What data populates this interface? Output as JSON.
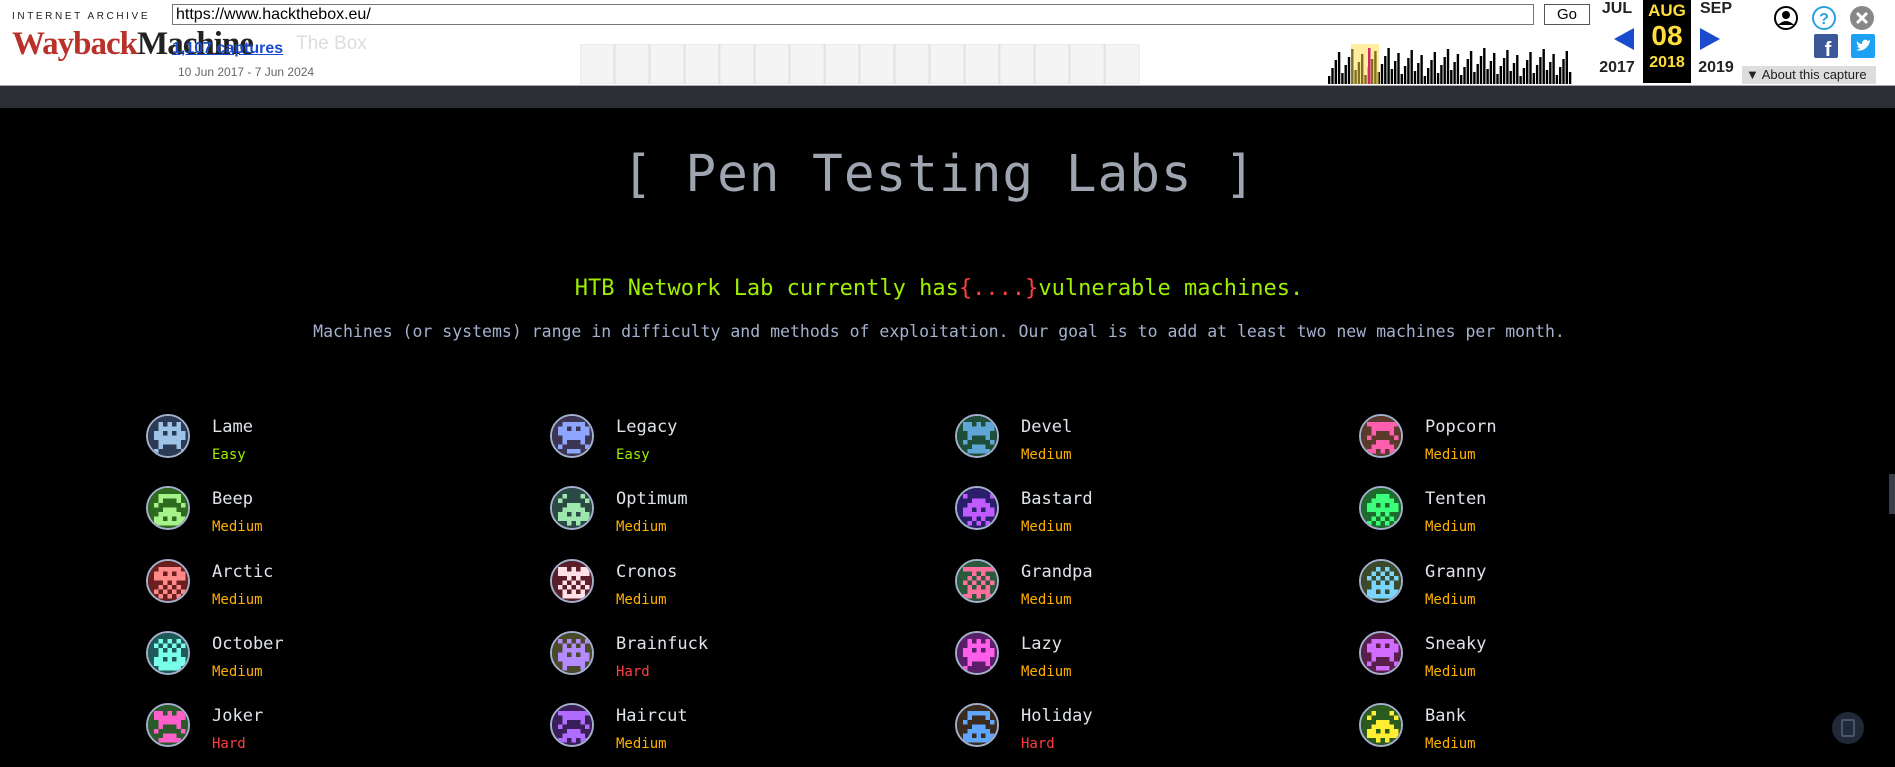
{
  "wayback": {
    "ia_label": "INTERNET ARCHIVE",
    "logo_red": "Wayback",
    "logo_dark": "Machine",
    "url": "https://www.hackthebox.eu/",
    "go_label": "Go",
    "captures": "1,107 captures",
    "date_range": "10 Jun 2017 - 7 Jun 2024",
    "ghost_text": "The Box",
    "prev_month": "JUL",
    "prev_year": "2017",
    "cur_month": "AUG",
    "cur_day": "08",
    "cur_year": "2018",
    "next_month": "SEP",
    "next_year": "2019",
    "about": "About this capture",
    "colors": {
      "logo_red": "#b8322a",
      "link_blue": "#1a4bcc",
      "highlight": "#ffde3b"
    }
  },
  "page": {
    "title": "[ Pen Testing Labs ]",
    "lab_prefix": "HTB Network Lab currently has",
    "lab_count": "{....}",
    "lab_suffix": "vulnerable machines.",
    "subtitle": "Machines (or systems) range in difficulty and methods of exploitation. Our goal is to add at least two new machines per month.",
    "colors": {
      "accent_green": "#9fef00",
      "easy": "#9fef00",
      "medium": "#ffaf00",
      "hard": "#ff3e3e"
    }
  },
  "machines": [
    {
      "name": "Lame",
      "difficulty": "Easy",
      "icon": "lame-avatar-icon"
    },
    {
      "name": "Legacy",
      "difficulty": "Easy",
      "icon": "legacy-avatar-icon"
    },
    {
      "name": "Devel",
      "difficulty": "Medium",
      "icon": "devel-avatar-icon"
    },
    {
      "name": "Popcorn",
      "difficulty": "Medium",
      "icon": "popcorn-avatar-icon"
    },
    {
      "name": "Beep",
      "difficulty": "Medium",
      "icon": "beep-avatar-icon"
    },
    {
      "name": "Optimum",
      "difficulty": "Medium",
      "icon": "optimum-avatar-icon"
    },
    {
      "name": "Bastard",
      "difficulty": "Medium",
      "icon": "bastard-avatar-icon"
    },
    {
      "name": "Tenten",
      "difficulty": "Medium",
      "icon": "tenten-avatar-icon"
    },
    {
      "name": "Arctic",
      "difficulty": "Medium",
      "icon": "arctic-avatar-icon"
    },
    {
      "name": "Cronos",
      "difficulty": "Medium",
      "icon": "cronos-avatar-icon"
    },
    {
      "name": "Grandpa",
      "difficulty": "Medium",
      "icon": "grandpa-avatar-icon"
    },
    {
      "name": "Granny",
      "difficulty": "Medium",
      "icon": "granny-avatar-icon"
    },
    {
      "name": "October",
      "difficulty": "Medium",
      "icon": "october-avatar-icon"
    },
    {
      "name": "Brainfuck",
      "difficulty": "Hard",
      "icon": "brainfuck-avatar-icon"
    },
    {
      "name": "Lazy",
      "difficulty": "Medium",
      "icon": "lazy-avatar-icon"
    },
    {
      "name": "Sneaky",
      "difficulty": "Medium",
      "icon": "sneaky-avatar-icon"
    },
    {
      "name": "Joker",
      "difficulty": "Hard",
      "icon": "joker-avatar-icon"
    },
    {
      "name": "Haircut",
      "difficulty": "Medium",
      "icon": "haircut-avatar-icon"
    },
    {
      "name": "Holiday",
      "difficulty": "Hard",
      "icon": "holiday-avatar-icon"
    },
    {
      "name": "Bank",
      "difficulty": "Medium",
      "icon": "bank-avatar-icon"
    }
  ]
}
